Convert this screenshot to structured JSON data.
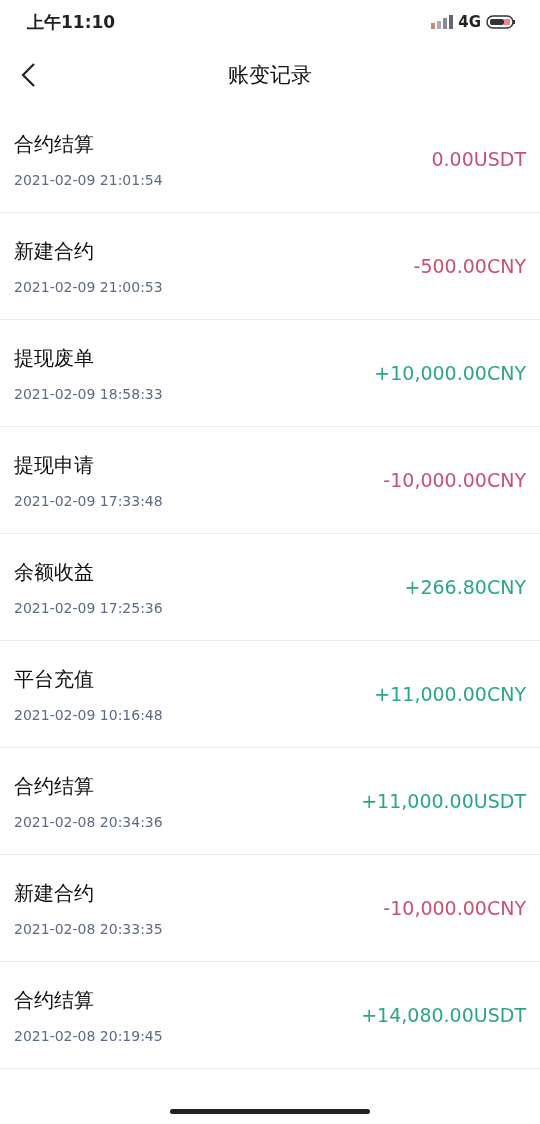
{
  "status_bar": {
    "time": "上午11:10",
    "network": "4G"
  },
  "header": {
    "title": "账变记录"
  },
  "records": [
    {
      "title": "合约结算",
      "time": "2021-02-09 21:01:54",
      "amount": "0.00USDT",
      "color": "#c9506f"
    },
    {
      "title": "新建合约",
      "time": "2021-02-09 21:00:53",
      "amount": "-500.00CNY",
      "color": "#c9506f"
    },
    {
      "title": "提现废单",
      "time": "2021-02-09 18:58:33",
      "amount": "+10,000.00CNY",
      "color": "#2aa58a"
    },
    {
      "title": "提现申请",
      "time": "2021-02-09 17:33:48",
      "amount": "-10,000.00CNY",
      "color": "#c9506f"
    },
    {
      "title": "余额收益",
      "time": "2021-02-09 17:25:36",
      "amount": "+266.80CNY",
      "color": "#2aa58a"
    },
    {
      "title": "平台充值",
      "time": "2021-02-09 10:16:48",
      "amount": "+11,000.00CNY",
      "color": "#2aa58a"
    },
    {
      "title": "合约结算",
      "time": "2021-02-08 20:34:36",
      "amount": "+11,000.00USDT",
      "color": "#2aa58a"
    },
    {
      "title": "新建合约",
      "time": "2021-02-08 20:33:35",
      "amount": "-10,000.00CNY",
      "color": "#c9506f"
    },
    {
      "title": "合约结算",
      "time": "2021-02-08 20:19:45",
      "amount": "+14,080.00USDT",
      "color": "#2aa58a"
    }
  ]
}
